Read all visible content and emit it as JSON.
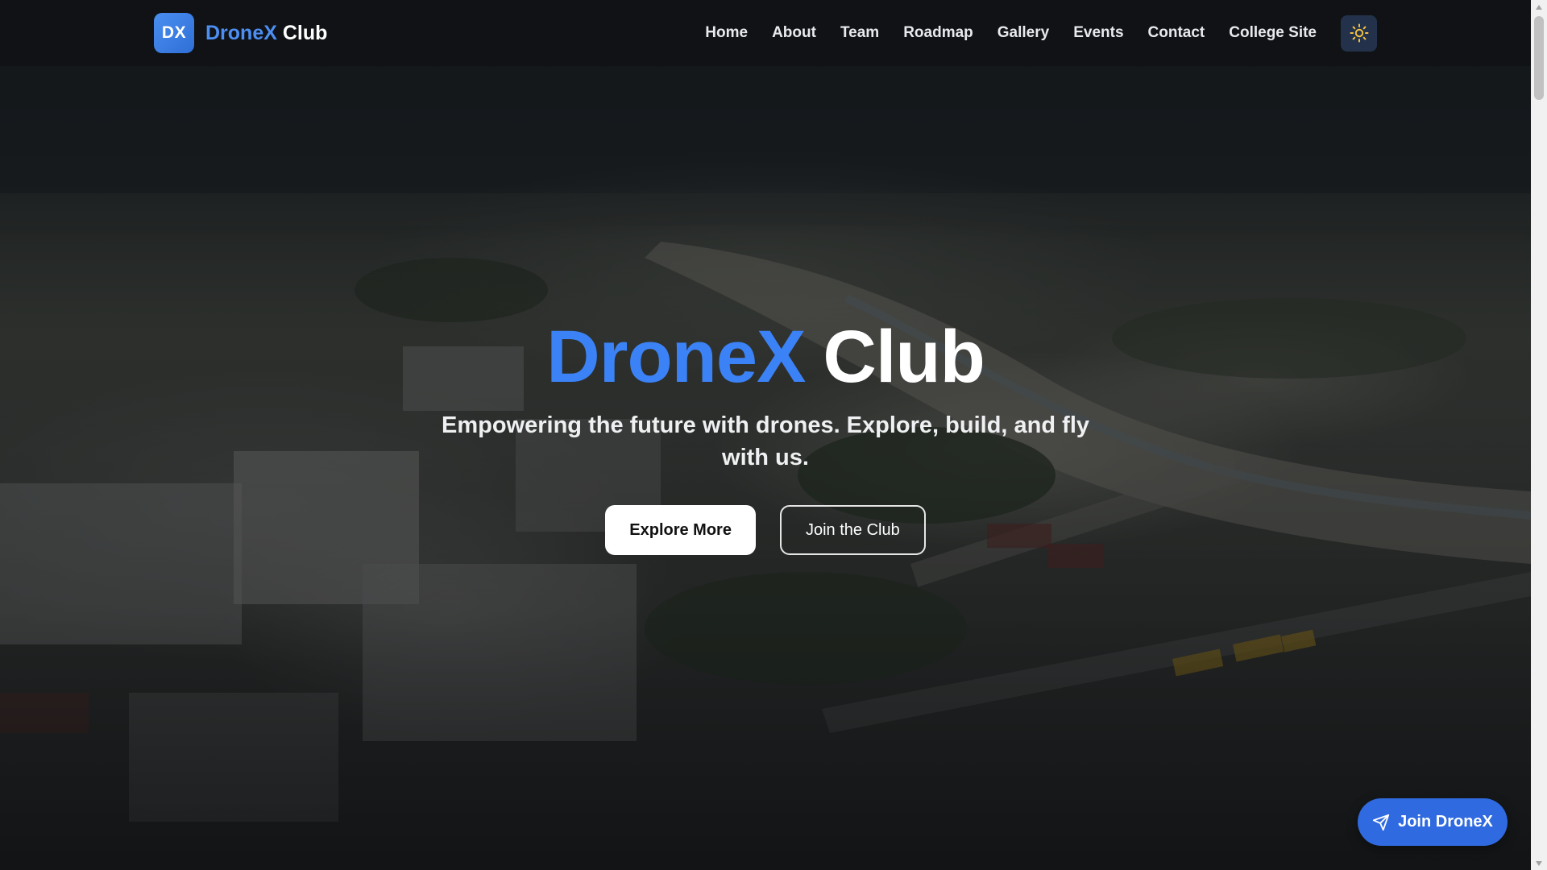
{
  "brand": {
    "logo_text": "DX",
    "name_accent": "DroneX",
    "name_rest": "Club"
  },
  "nav": {
    "items": [
      {
        "label": "Home"
      },
      {
        "label": "About"
      },
      {
        "label": "Team"
      },
      {
        "label": "Roadmap"
      },
      {
        "label": "Gallery"
      },
      {
        "label": "Events"
      },
      {
        "label": "Contact"
      },
      {
        "label": "College Site"
      }
    ],
    "theme_toggle_icon": "sun-icon"
  },
  "hero": {
    "title_accent": "DroneX",
    "title_rest": "Club",
    "subtitle": "Empowering the future with drones. Explore, build, and fly with us.",
    "primary_button": "Explore More",
    "secondary_button": "Join the Club"
  },
  "floating_cta": {
    "label": "Join DroneX",
    "icon": "send-icon"
  },
  "colors": {
    "accent": "#3b82f6",
    "logo_badge": "#3a7fe8",
    "fab": "#2f6ae0",
    "toggle_bg": "#23324a",
    "sun": "#f5c242"
  }
}
